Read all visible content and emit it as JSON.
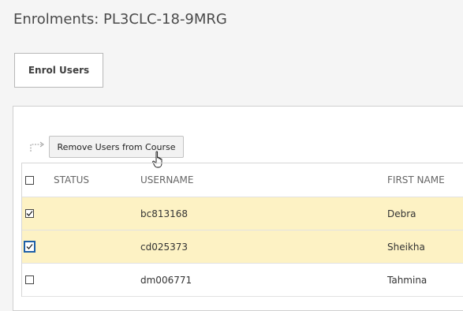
{
  "page": {
    "title": "Enrolments: PL3CLC-18-9MRG"
  },
  "toolbar": {
    "enrol_label": "Enrol Users",
    "remove_label": "Remove Users from Course"
  },
  "table": {
    "columns": {
      "status": "STATUS",
      "username": "USERNAME",
      "first_name": "FIRST NAME"
    },
    "select_all_checked": false,
    "rows": [
      {
        "status": "",
        "username": "bc813168",
        "first_name": "Debra",
        "checked": true,
        "selected": true
      },
      {
        "status": "",
        "username": "cd025373",
        "first_name": "Sheikha",
        "checked": true,
        "selected": true,
        "focused": true
      },
      {
        "status": "",
        "username": "dm006771",
        "first_name": "Tahmina",
        "checked": false,
        "selected": false
      }
    ]
  },
  "colors": {
    "selected_row": "#fdf2c4",
    "focus_ring": "#1d5fa8"
  }
}
